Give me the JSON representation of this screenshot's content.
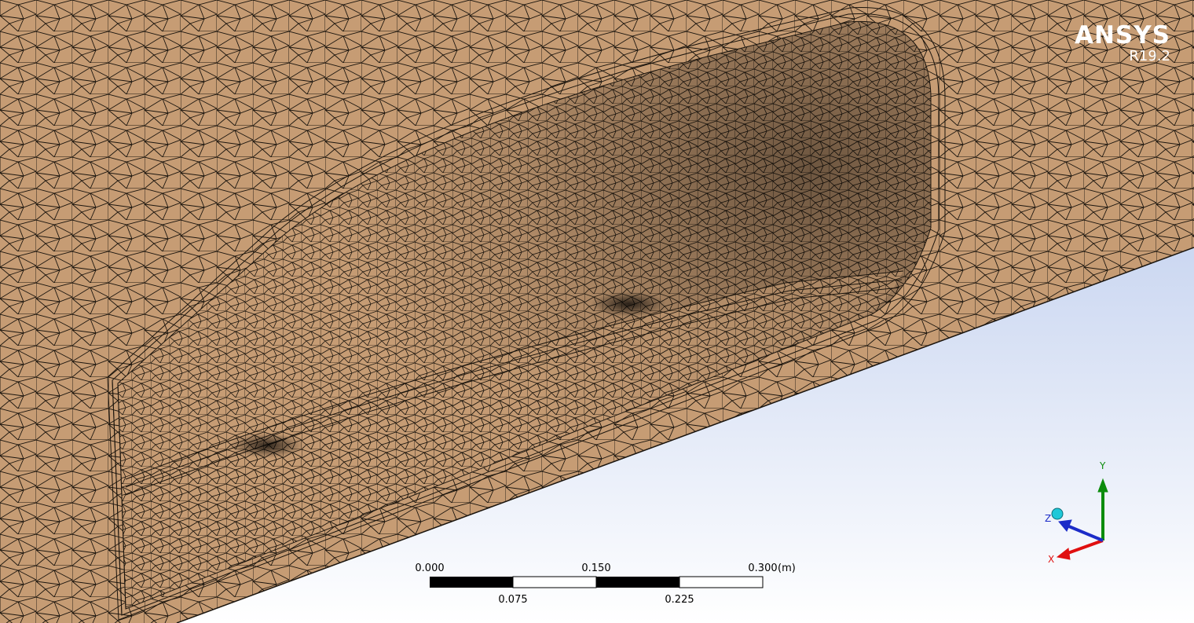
{
  "logo": {
    "brand": "ANSYS",
    "version": "R19.2"
  },
  "scale_bar": {
    "unit": "(m)",
    "top_ticks": [
      "0.000",
      "0.150",
      "0.300"
    ],
    "bottom_ticks": [
      "0.075",
      "0.225"
    ]
  },
  "triad": {
    "x_label": "X",
    "y_label": "Y",
    "z_label": "Z"
  },
  "colors": {
    "mesh_fill": "#c69c74",
    "mesh_shadow": "#6e5234",
    "background_top": "#a9bde8",
    "background_bottom": "#ffffff",
    "axis_x": "#e01010",
    "axis_y": "#0c8c0c",
    "axis_z": "#1c2cc8"
  }
}
